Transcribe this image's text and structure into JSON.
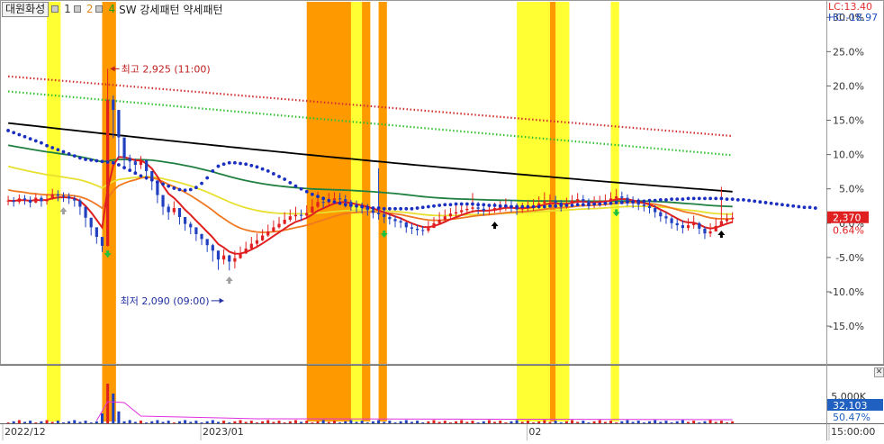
{
  "toolbar": {
    "stock_name": "대원화성",
    "items": [
      {
        "label": "1",
        "color": "#333333"
      },
      {
        "label": "2",
        "color": "#e08820"
      },
      {
        "label": "4",
        "color": "#20a020"
      },
      {
        "label": "SW 강세패턴  약세패턴",
        "color": "#222222"
      }
    ]
  },
  "range_labels": {
    "lc": "LC:13.40",
    "hc": "HC:-18.97"
  },
  "colors": {
    "up": "#e02020",
    "down": "#2040c0",
    "band_orange": "#ff9900",
    "band_yellow": "#ffff33",
    "ma_black": "#000000",
    "ma_green": "#208040",
    "ma_yellow": "#e8e030",
    "ma_orange": "#f07820",
    "ma_red": "#e02020",
    "dots_blue": "#1a2fc0",
    "env_red": "#d03030",
    "env_green": "#30c030"
  },
  "chart_data": {
    "type": "candlestick",
    "y_axis_unit": "%",
    "y_ticks": [
      "30.0%",
      "25.0%",
      "20.0%",
      "15.0%",
      "10.0%",
      "5.0%",
      "0.0%",
      "-5.0%",
      "-10.0%",
      "-15.0%"
    ],
    "y_tick_values": [
      30,
      25,
      20,
      15,
      10,
      5,
      0,
      -5,
      -10,
      -15
    ],
    "ylim": [
      -20.5,
      32.0
    ],
    "x_labels": [
      "2022/12",
      "2023/01",
      "02",
      "15:00:00"
    ],
    "current_price": "2,370",
    "current_change": "0.64%",
    "annotations": {
      "high": {
        "text": "최고 2,925 (11:00)",
        "value": 22.5
      },
      "low": {
        "text": "최저 2,090 (09:00)",
        "value": -11.3
      }
    },
    "volume_panel": {
      "labels": [
        "5,000K"
      ],
      "current_volume": "32,103",
      "current_ratio": "50.47%"
    },
    "highlight_bands": [
      {
        "start": 7.5,
        "end": 9.5,
        "color": "yellow"
      },
      {
        "start": 17.5,
        "end": 19.5,
        "color": "orange"
      },
      {
        "start": 54.5,
        "end": 62.5,
        "color": "orange"
      },
      {
        "start": 62.5,
        "end": 64.5,
        "color": "yellow"
      },
      {
        "start": 64.5,
        "end": 65.5,
        "color": "orange"
      },
      {
        "start": 67.5,
        "end": 68.5,
        "color": "orange"
      },
      {
        "start": 92.5,
        "end": 98.5,
        "color": "yellow"
      },
      {
        "start": 98.5,
        "end": 99.5,
        "color": "orange"
      },
      {
        "start": 99.5,
        "end": 101.5,
        "color": "yellow"
      },
      {
        "start": 109.5,
        "end": 110.5,
        "color": "yellow"
      }
    ],
    "series": [
      {
        "name": "",
        "close": [
          3.3,
          3.1,
          3.6,
          3.4,
          3.0,
          3.7,
          3.2,
          3.5,
          4.2,
          4.0,
          3.9,
          3.6,
          3.3,
          2.4,
          0.8,
          -0.6,
          -2.0,
          -3.3,
          18.0,
          16.5,
          12.5,
          9.5,
          9.0,
          8.5,
          9.2,
          7.6,
          6.2,
          4.1,
          2.4,
          1.6,
          2.2,
          0.9,
          -0.1,
          -0.6,
          -1.6,
          -2.3,
          -3.2,
          -4.0,
          -5.3,
          -4.7,
          -5.6,
          -5.1,
          -4.4,
          -3.7,
          -3.0,
          -2.5,
          -1.8,
          -1.2,
          -0.6,
          -0.1,
          0.5,
          1.0,
          1.2,
          1.1,
          1.5,
          2.4,
          3.1,
          3.0,
          3.4,
          3.6,
          3.5,
          3.1,
          2.6,
          2.4,
          2.2,
          1.9,
          1.5,
          1.3,
          0.9,
          0.6,
          0.3,
          0.1,
          -0.6,
          -0.8,
          -1.0,
          -1.1,
          -0.7,
          0.0,
          0.5,
          1.0,
          1.4,
          1.6,
          1.9,
          2.1,
          2.3,
          2.1,
          1.8,
          1.9,
          2.2,
          2.4,
          2.6,
          2.3,
          2.0,
          2.2,
          2.4,
          2.5,
          2.9,
          3.2,
          3.3,
          3.0,
          2.5,
          2.9,
          3.3,
          3.5,
          3.2,
          2.8,
          3.0,
          3.2,
          3.3,
          3.6,
          3.9,
          3.7,
          3.3,
          3.0,
          2.7,
          2.5,
          2.2,
          1.6,
          1.0,
          0.7,
          0.0,
          -0.3,
          -0.7,
          -0.3,
          0.0,
          -0.8,
          -1.5,
          -1.2,
          -0.4,
          0.3,
          0.6,
          0.8
        ],
        "high": [
          4.0,
          3.8,
          4.2,
          4.1,
          3.9,
          4.3,
          4.0,
          4.2,
          5.0,
          4.8,
          4.5,
          4.4,
          4.0,
          3.6,
          2.0,
          0.6,
          -0.9,
          -2.6,
          22.5,
          18.6,
          16.5,
          11.5,
          10.0,
          9.4,
          9.8,
          8.4,
          7.4,
          5.6,
          3.4,
          2.8,
          3.2,
          2.2,
          0.6,
          0.2,
          -0.9,
          -1.5,
          -2.4,
          -3.0,
          -4.0,
          -3.8,
          -4.6,
          -4.0,
          -3.4,
          -2.7,
          -2.0,
          -1.5,
          -0.9,
          -0.2,
          0.4,
          0.9,
          1.6,
          2.0,
          2.4,
          2.0,
          2.6,
          3.5,
          4.6,
          3.9,
          4.4,
          4.5,
          4.4,
          4.1,
          3.4,
          3.3,
          3.0,
          2.8,
          2.2,
          8.0,
          2.1,
          1.4,
          1.1,
          0.8,
          0.2,
          0.0,
          -0.2,
          -0.4,
          0.3,
          0.9,
          1.6,
          2.0,
          2.2,
          2.6,
          2.8,
          2.9,
          4.4,
          3.1,
          2.7,
          2.8,
          3.0,
          3.2,
          3.6,
          3.4,
          2.9,
          3.0,
          3.3,
          3.5,
          3.9,
          4.5,
          4.2,
          4.0,
          3.4,
          3.7,
          4.1,
          4.4,
          4.1,
          3.6,
          3.9,
          4.0,
          4.2,
          4.5,
          5.0,
          4.6,
          4.2,
          3.9,
          3.6,
          3.4,
          3.1,
          2.6,
          1.9,
          1.6,
          1.0,
          0.6,
          0.4,
          0.7,
          1.1,
          0.2,
          -0.5,
          0.0,
          0.7,
          5.3,
          1.4,
          1.6
        ],
        "low": [
          2.6,
          2.4,
          2.8,
          2.7,
          2.3,
          2.9,
          2.4,
          2.7,
          3.4,
          3.2,
          3.1,
          2.8,
          2.4,
          1.2,
          -0.6,
          -1.8,
          -3.0,
          -4.2,
          -3.4,
          12.4,
          9.5,
          7.8,
          7.6,
          7.4,
          7.9,
          6.3,
          4.8,
          2.9,
          1.2,
          0.5,
          1.2,
          -0.2,
          -1.1,
          -1.6,
          -2.6,
          -3.2,
          -4.2,
          -5.6,
          -6.8,
          -6.0,
          -6.9,
          -6.6,
          -5.2,
          -4.5,
          -3.8,
          -3.4,
          -2.6,
          -2.0,
          -1.3,
          -0.8,
          -0.2,
          0.2,
          0.4,
          0.3,
          0.7,
          1.6,
          2.2,
          2.2,
          2.6,
          2.8,
          2.7,
          2.3,
          1.8,
          1.6,
          1.4,
          1.1,
          0.7,
          0.5,
          0.0,
          -0.2,
          -0.6,
          -0.7,
          -1.4,
          -1.6,
          -1.8,
          -1.8,
          -1.4,
          -0.6,
          -0.2,
          0.3,
          0.6,
          0.8,
          1.1,
          1.3,
          1.5,
          1.3,
          1.1,
          1.2,
          1.5,
          1.6,
          1.8,
          1.6,
          1.2,
          1.5,
          1.7,
          1.8,
          2.1,
          2.4,
          2.4,
          2.2,
          1.7,
          2.1,
          2.5,
          2.7,
          2.4,
          2.0,
          2.2,
          2.4,
          2.5,
          2.8,
          3.1,
          2.9,
          2.5,
          2.2,
          1.9,
          1.7,
          1.4,
          0.8,
          0.2,
          -0.1,
          -0.8,
          -1.1,
          -1.5,
          -1.1,
          -0.8,
          -1.6,
          -2.3,
          -2.0,
          -1.2,
          -0.5,
          -0.2,
          0.0
        ]
      }
    ]
  }
}
